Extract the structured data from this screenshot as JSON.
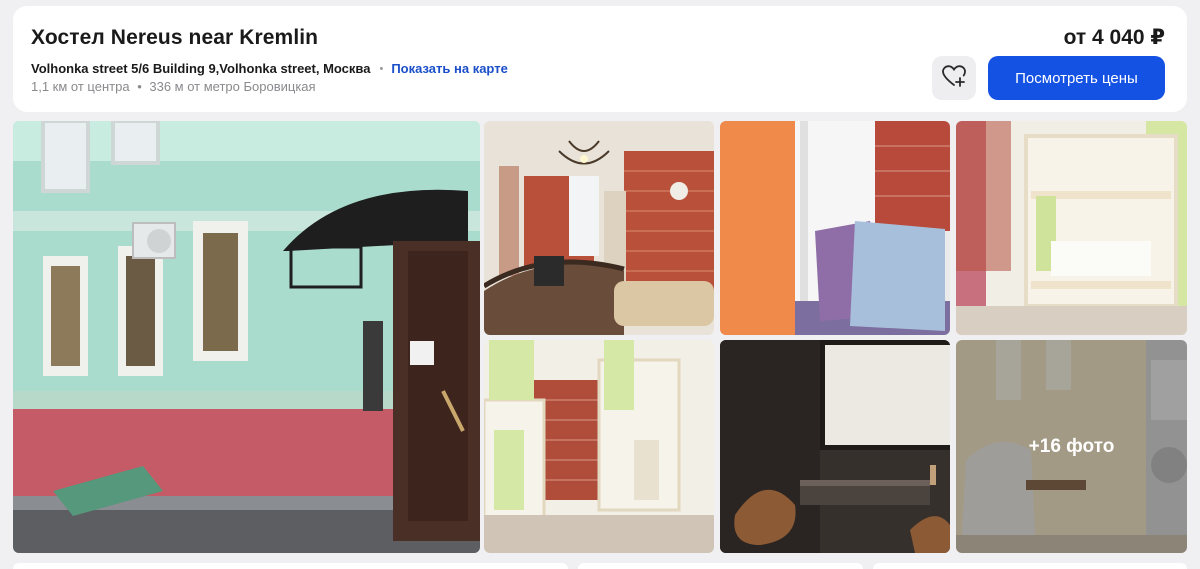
{
  "hotel": {
    "title": "Хостел Nereus near Kremlin",
    "address": "Volhonka street 5/6 Building 9,Volhonka street, Москва",
    "separator_dot": "•",
    "map_link": "Показать на карте",
    "distance_center": "1,1 км  от центра",
    "distance_separator": "•",
    "distance_metro": "336 м  от метро Боровицкая"
  },
  "pricing": {
    "price_label": "от 4 040 ₽",
    "view_prices_button": "Посмотреть цены"
  },
  "icons": {
    "favorite": "heart-plus-icon"
  },
  "gallery": {
    "photos": [
      {
        "subject": "building-facade"
      },
      {
        "subject": "reception-lobby"
      },
      {
        "subject": "window-pillows"
      },
      {
        "subject": "bunk-beds-room"
      },
      {
        "subject": "bunk-beds-room-2"
      },
      {
        "subject": "lounge-screen"
      },
      {
        "subject": "laundry-room"
      }
    ],
    "more_label": "+16 фото"
  },
  "colors": {
    "accent": "#1452e3",
    "link": "#1a4fc9",
    "page_bg": "#f0f0f2",
    "card_bg": "#ffffff"
  }
}
